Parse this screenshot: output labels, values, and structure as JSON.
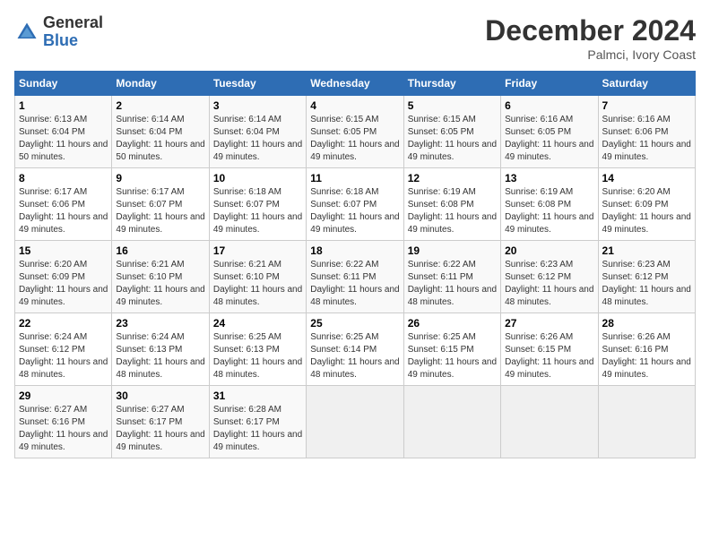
{
  "logo": {
    "general": "General",
    "blue": "Blue"
  },
  "header": {
    "title": "December 2024",
    "subtitle": "Palmci, Ivory Coast"
  },
  "weekdays": [
    "Sunday",
    "Monday",
    "Tuesday",
    "Wednesday",
    "Thursday",
    "Friday",
    "Saturday"
  ],
  "weeks": [
    [
      {
        "day": "1",
        "sunrise": "6:13 AM",
        "sunset": "6:04 PM",
        "daylight": "11 hours and 50 minutes."
      },
      {
        "day": "2",
        "sunrise": "6:14 AM",
        "sunset": "6:04 PM",
        "daylight": "11 hours and 50 minutes."
      },
      {
        "day": "3",
        "sunrise": "6:14 AM",
        "sunset": "6:04 PM",
        "daylight": "11 hours and 49 minutes."
      },
      {
        "day": "4",
        "sunrise": "6:15 AM",
        "sunset": "6:05 PM",
        "daylight": "11 hours and 49 minutes."
      },
      {
        "day": "5",
        "sunrise": "6:15 AM",
        "sunset": "6:05 PM",
        "daylight": "11 hours and 49 minutes."
      },
      {
        "day": "6",
        "sunrise": "6:16 AM",
        "sunset": "6:05 PM",
        "daylight": "11 hours and 49 minutes."
      },
      {
        "day": "7",
        "sunrise": "6:16 AM",
        "sunset": "6:06 PM",
        "daylight": "11 hours and 49 minutes."
      }
    ],
    [
      {
        "day": "8",
        "sunrise": "6:17 AM",
        "sunset": "6:06 PM",
        "daylight": "11 hours and 49 minutes."
      },
      {
        "day": "9",
        "sunrise": "6:17 AM",
        "sunset": "6:07 PM",
        "daylight": "11 hours and 49 minutes."
      },
      {
        "day": "10",
        "sunrise": "6:18 AM",
        "sunset": "6:07 PM",
        "daylight": "11 hours and 49 minutes."
      },
      {
        "day": "11",
        "sunrise": "6:18 AM",
        "sunset": "6:07 PM",
        "daylight": "11 hours and 49 minutes."
      },
      {
        "day": "12",
        "sunrise": "6:19 AM",
        "sunset": "6:08 PM",
        "daylight": "11 hours and 49 minutes."
      },
      {
        "day": "13",
        "sunrise": "6:19 AM",
        "sunset": "6:08 PM",
        "daylight": "11 hours and 49 minutes."
      },
      {
        "day": "14",
        "sunrise": "6:20 AM",
        "sunset": "6:09 PM",
        "daylight": "11 hours and 49 minutes."
      }
    ],
    [
      {
        "day": "15",
        "sunrise": "6:20 AM",
        "sunset": "6:09 PM",
        "daylight": "11 hours and 49 minutes."
      },
      {
        "day": "16",
        "sunrise": "6:21 AM",
        "sunset": "6:10 PM",
        "daylight": "11 hours and 49 minutes."
      },
      {
        "day": "17",
        "sunrise": "6:21 AM",
        "sunset": "6:10 PM",
        "daylight": "11 hours and 48 minutes."
      },
      {
        "day": "18",
        "sunrise": "6:22 AM",
        "sunset": "6:11 PM",
        "daylight": "11 hours and 48 minutes."
      },
      {
        "day": "19",
        "sunrise": "6:22 AM",
        "sunset": "6:11 PM",
        "daylight": "11 hours and 48 minutes."
      },
      {
        "day": "20",
        "sunrise": "6:23 AM",
        "sunset": "6:12 PM",
        "daylight": "11 hours and 48 minutes."
      },
      {
        "day": "21",
        "sunrise": "6:23 AM",
        "sunset": "6:12 PM",
        "daylight": "11 hours and 48 minutes."
      }
    ],
    [
      {
        "day": "22",
        "sunrise": "6:24 AM",
        "sunset": "6:12 PM",
        "daylight": "11 hours and 48 minutes."
      },
      {
        "day": "23",
        "sunrise": "6:24 AM",
        "sunset": "6:13 PM",
        "daylight": "11 hours and 48 minutes."
      },
      {
        "day": "24",
        "sunrise": "6:25 AM",
        "sunset": "6:13 PM",
        "daylight": "11 hours and 48 minutes."
      },
      {
        "day": "25",
        "sunrise": "6:25 AM",
        "sunset": "6:14 PM",
        "daylight": "11 hours and 48 minutes."
      },
      {
        "day": "26",
        "sunrise": "6:25 AM",
        "sunset": "6:15 PM",
        "daylight": "11 hours and 49 minutes."
      },
      {
        "day": "27",
        "sunrise": "6:26 AM",
        "sunset": "6:15 PM",
        "daylight": "11 hours and 49 minutes."
      },
      {
        "day": "28",
        "sunrise": "6:26 AM",
        "sunset": "6:16 PM",
        "daylight": "11 hours and 49 minutes."
      }
    ],
    [
      {
        "day": "29",
        "sunrise": "6:27 AM",
        "sunset": "6:16 PM",
        "daylight": "11 hours and 49 minutes."
      },
      {
        "day": "30",
        "sunrise": "6:27 AM",
        "sunset": "6:17 PM",
        "daylight": "11 hours and 49 minutes."
      },
      {
        "day": "31",
        "sunrise": "6:28 AM",
        "sunset": "6:17 PM",
        "daylight": "11 hours and 49 minutes."
      },
      null,
      null,
      null,
      null
    ]
  ]
}
